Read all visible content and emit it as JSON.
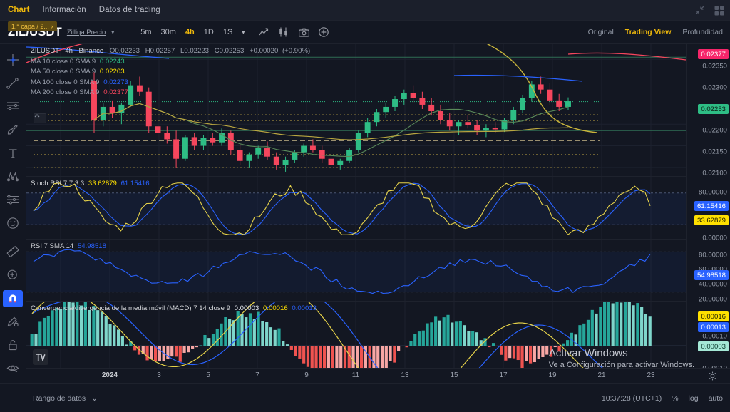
{
  "topnav": {
    "items": [
      {
        "label": "Chart",
        "active": true
      },
      {
        "label": "Información",
        "active": false
      },
      {
        "label": "Datos de trading",
        "active": false
      }
    ],
    "collapse_icon": "collapse-arrows-icon",
    "layout_icon": "grid-layout-icon"
  },
  "symbar": {
    "symbol": "ZIL/USDT",
    "subtitle": "Zilliqa Precio",
    "caret": "▾",
    "layer_badge": "1.ª capa / 2... ›",
    "timeframes": [
      {
        "label": "5m",
        "active": false
      },
      {
        "label": "30m",
        "active": false
      },
      {
        "label": "4h",
        "active": true
      },
      {
        "label": "1D",
        "active": false
      },
      {
        "label": "1S",
        "active": false
      }
    ],
    "more_caret": "▾",
    "icons": [
      "line-chart-icon",
      "candlestick-icon",
      "camera-icon",
      "add-indicator-icon"
    ],
    "modes": [
      {
        "label": "Original",
        "active": false
      },
      {
        "label": "Trading View",
        "active": true
      },
      {
        "label": "Profundidad",
        "active": false
      }
    ]
  },
  "left_toolbar": {
    "items": [
      {
        "name": "crosshair-icon",
        "selected": false
      },
      {
        "name": "trend-line-icon",
        "selected": false
      },
      {
        "name": "horizontal-lines-icon",
        "selected": false
      },
      {
        "name": "brush-icon",
        "selected": false
      },
      {
        "name": "text-icon",
        "selected": false
      },
      {
        "name": "pattern-icon",
        "selected": false
      },
      {
        "name": "forecast-icon",
        "selected": false
      },
      {
        "name": "emoji-icon",
        "selected": false
      },
      {
        "name": "measure-ruler-icon",
        "selected": false
      },
      {
        "name": "zoom-in-icon",
        "selected": false
      },
      {
        "name": "magnet-icon",
        "selected": true
      },
      {
        "name": "draw-lock-icon",
        "selected": false
      },
      {
        "name": "lock-icon",
        "selected": false
      },
      {
        "name": "eye-hide-icon",
        "selected": false
      },
      {
        "name": "trash-icon",
        "selected": false
      }
    ]
  },
  "price_pane": {
    "title": "ZILUSDT · 4h · Binance",
    "ohlc": {
      "o_label": "O",
      "o": "0.02233",
      "h_label": "H",
      "h": "0.02257",
      "l_label": "L",
      "l": "0.02223",
      "c_label": "C",
      "c": "0.02253",
      "change": "+0.00020",
      "change_pct": "(+0.90%)"
    },
    "mas": [
      {
        "label": "MA 10 close 0 SMA 9",
        "value": "0.02243",
        "color": "#2ebd85"
      },
      {
        "label": "MA 50 close 0 SMA 9",
        "value": "0.02203",
        "color": "#ffe000"
      },
      {
        "label": "MA 100 close 0 SMA 9",
        "value": "0.02273",
        "color": "#2962ff"
      },
      {
        "label": "MA 200 close 0 SMA 9",
        "value": "0.02377",
        "color": "#f6465d"
      }
    ],
    "collapse_caret": "︿"
  },
  "stoch_pane": {
    "title": "Stoch RSI 7 7 3 3",
    "value_k": "33.62879",
    "value_d": "61.15416"
  },
  "rsi_pane": {
    "title": "RSI 7 SMA 14",
    "value": "54.98518"
  },
  "macd_pane": {
    "title": "Convergencia/divergencia de la media móvil (MACD) 7 14 close 9",
    "hist": "0.00003",
    "macd": "0.00016",
    "signal": "0.00013"
  },
  "price_scale": {
    "labels": [
      "0.02350",
      "0.02300",
      "0.02200",
      "0.02150",
      "0.02100"
    ],
    "tags": [
      {
        "value": "0.02377",
        "style": "pink"
      },
      {
        "value": "0.02253",
        "style": "green"
      }
    ],
    "stoch_labels": [
      "80.00000",
      "0.00000"
    ],
    "stoch_tags": [
      {
        "value": "61.15416",
        "style": "blue"
      },
      {
        "value": "33.62879",
        "style": "yellow"
      }
    ],
    "rsi_labels": [
      "80.00000",
      "60.00000",
      "40.00000",
      "20.00000"
    ],
    "rsi_tags": [
      {
        "value": "54.98518",
        "style": "blue"
      }
    ],
    "macd_labels": [
      "0.00010",
      "-0.00010"
    ],
    "macd_tags": [
      {
        "value": "0.00016",
        "style": "yellow"
      },
      {
        "value": "0.00013",
        "style": "blue"
      },
      {
        "value": "0.00003",
        "style": "teal"
      }
    ]
  },
  "time_axis": {
    "labels": [
      "2024",
      "3",
      "5",
      "7",
      "9",
      "11",
      "13",
      "15",
      "17",
      "19",
      "21",
      "23"
    ],
    "gear_icon": "settings-gear-icon"
  },
  "bottom_bar": {
    "layers_icon": "layers-icon",
    "range_label": "Rango de datos",
    "range_caret": "⌄",
    "clock": "10:37:28 (UTC+1)",
    "percent": "%",
    "log": "log",
    "auto": "auto"
  },
  "watermark": {
    "line1": "Activar Windows",
    "line2": "Ve a Configuración para activar Windows."
  },
  "tv_logo": "tradingview-logo-icon",
  "chart_data": {
    "type": "line",
    "title": "ZILUSDT · 4h · Binance",
    "xlabel": "",
    "ylabel": "",
    "ylim": [
      0.0208,
      0.02385
    ],
    "x": [
      "2024",
      "3",
      "5",
      "7",
      "9",
      "11",
      "13",
      "15",
      "17",
      "19",
      "21",
      "23"
    ],
    "series": [
      {
        "name": "MA 10",
        "color": "#2ebd85",
        "last": 0.02243
      },
      {
        "name": "MA 50",
        "color": "#ffe000",
        "last": 0.02203
      },
      {
        "name": "MA 100",
        "color": "#2962ff",
        "last": 0.02273
      },
      {
        "name": "MA 200",
        "color": "#f6465d",
        "last": 0.02377
      }
    ],
    "ohlc_last": {
      "o": 0.02233,
      "h": 0.02257,
      "l": 0.02223,
      "c": 0.02253
    },
    "candles": [
      [
        0.023,
        0.0232,
        0.0218,
        0.0221
      ],
      [
        0.0221,
        0.0225,
        0.02195,
        0.0224
      ],
      [
        0.0224,
        0.02255,
        0.02215,
        0.02225
      ],
      [
        0.02225,
        0.0225,
        0.022,
        0.02245
      ],
      [
        0.02245,
        0.023,
        0.0224,
        0.0229
      ],
      [
        0.0229,
        0.0231,
        0.02265,
        0.02275
      ],
      [
        0.02275,
        0.02285,
        0.0218,
        0.02195
      ],
      [
        0.02195,
        0.0221,
        0.0217,
        0.0218
      ],
      [
        0.0218,
        0.02195,
        0.02155,
        0.02165
      ],
      [
        0.02165,
        0.02185,
        0.021,
        0.0212
      ],
      [
        0.0212,
        0.02175,
        0.02115,
        0.0217
      ],
      [
        0.0217,
        0.0218,
        0.0214,
        0.0215
      ],
      [
        0.0215,
        0.02175,
        0.0214,
        0.02168
      ],
      [
        0.02168,
        0.0218,
        0.0215,
        0.02158
      ],
      [
        0.02158,
        0.0219,
        0.0215,
        0.0218
      ],
      [
        0.0218,
        0.02185,
        0.0213,
        0.0214
      ],
      [
        0.0214,
        0.02155,
        0.02105,
        0.02115
      ],
      [
        0.02115,
        0.02135,
        0.021,
        0.0213
      ],
      [
        0.0213,
        0.0215,
        0.0212,
        0.02145
      ],
      [
        0.02145,
        0.0216,
        0.02118,
        0.02125
      ],
      [
        0.02125,
        0.02135,
        0.02095,
        0.02105
      ],
      [
        0.02105,
        0.02125,
        0.0209,
        0.02118
      ],
      [
        0.02118,
        0.0214,
        0.0211,
        0.02135
      ],
      [
        0.02135,
        0.02155,
        0.02125,
        0.0215
      ],
      [
        0.0215,
        0.02165,
        0.02135,
        0.0214
      ],
      [
        0.0214,
        0.0215,
        0.0211,
        0.0212
      ],
      [
        0.0212,
        0.0213,
        0.02098,
        0.02105
      ],
      [
        0.02105,
        0.0212,
        0.02095,
        0.02115
      ],
      [
        0.02115,
        0.02145,
        0.0211,
        0.0214
      ],
      [
        0.0214,
        0.02185,
        0.02135,
        0.0218
      ],
      [
        0.0218,
        0.02215,
        0.0217,
        0.02205
      ],
      [
        0.02205,
        0.02235,
        0.02195,
        0.02228
      ],
      [
        0.02228,
        0.0225,
        0.02215,
        0.0224
      ],
      [
        0.0224,
        0.02265,
        0.0223,
        0.02258
      ],
      [
        0.02258,
        0.0228,
        0.02245,
        0.02272
      ],
      [
        0.02272,
        0.0229,
        0.0225,
        0.0226
      ],
      [
        0.0226,
        0.02275,
        0.02235,
        0.02245
      ],
      [
        0.02245,
        0.0226,
        0.0222,
        0.0223
      ],
      [
        0.0223,
        0.02245,
        0.022,
        0.0221
      ],
      [
        0.0221,
        0.02225,
        0.02185,
        0.02195
      ],
      [
        0.02195,
        0.0221,
        0.02175,
        0.02205
      ],
      [
        0.02205,
        0.0222,
        0.0219,
        0.02198
      ],
      [
        0.02198,
        0.0221,
        0.02175,
        0.02185
      ],
      [
        0.02185,
        0.022,
        0.0217,
        0.02192
      ],
      [
        0.02192,
        0.02205,
        0.0218,
        0.02188
      ],
      [
        0.02188,
        0.02215,
        0.02182,
        0.0221
      ],
      [
        0.0221,
        0.0224,
        0.022,
        0.02232
      ],
      [
        0.02232,
        0.02268,
        0.02225,
        0.0226
      ],
      [
        0.0226,
        0.023,
        0.02252,
        0.02292
      ],
      [
        0.02292,
        0.0231,
        0.0227,
        0.0228
      ],
      [
        0.0228,
        0.02295,
        0.02245,
        0.02255
      ],
      [
        0.02255,
        0.0227,
        0.0223,
        0.0224
      ],
      [
        0.0224,
        0.02262,
        0.02233,
        0.02253
      ]
    ]
  }
}
